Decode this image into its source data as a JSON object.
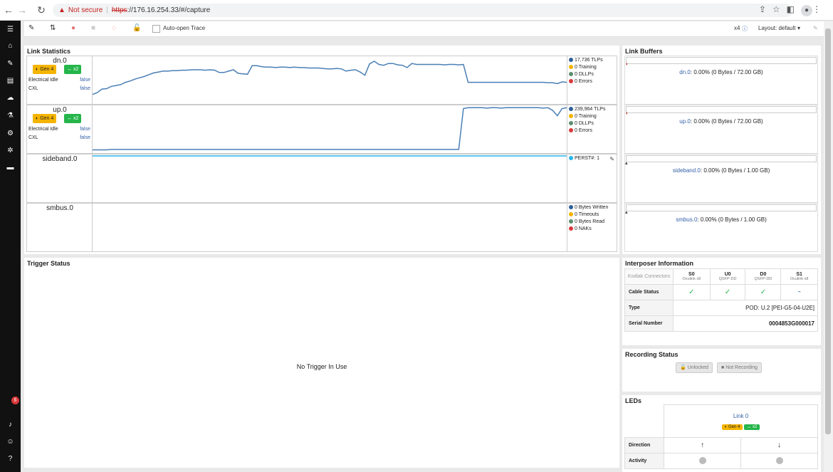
{
  "browser": {
    "warning": "Not secure",
    "url_protocol": "https",
    "url_rest": "://176.16.254.33/#/capture"
  },
  "notifications": {
    "count": "6"
  },
  "toolbar": {
    "auto_open_label": "Auto-open Trace",
    "zoom": "x4",
    "layout_label": "Layout: default"
  },
  "link_statistics": {
    "title": "Link Statistics",
    "rows": [
      {
        "name": "dn.0",
        "gen": "Gen 4",
        "width": "x2",
        "idle_label": "Electrical Idle",
        "idle_value": "false",
        "cxl_label": "CXL",
        "cxl_value": "false",
        "legend": [
          "17,736 TLPs",
          "0 Training",
          "0 DLLPs",
          "0 Errors"
        ]
      },
      {
        "name": "up.0",
        "gen": "Gen 4",
        "width": "x2",
        "idle_label": "Electrical Idle",
        "idle_value": "false",
        "cxl_label": "CXL",
        "cxl_value": "false",
        "legend": [
          "239,964 TLPs",
          "0 Training",
          "0 DLLPs",
          "0 Errors"
        ]
      },
      {
        "name": "sideband.0",
        "legend": [
          "PERST#: 1"
        ]
      },
      {
        "name": "smbus.0",
        "legend": [
          "0 Bytes Written",
          "0 Timeouts",
          "0 Bytes Read",
          "0 NAKs"
        ]
      }
    ],
    "legend_colors": [
      "#2e5f99",
      "#f4b400",
      "#5b8e6f",
      "#d9383a"
    ],
    "sideband_color": "#29b6e8"
  },
  "chart_data": {
    "type": "line",
    "series": [
      {
        "values": [
          18,
          22,
          30,
          31,
          36,
          38,
          40,
          45,
          48,
          52,
          55,
          58,
          62,
          66,
          68,
          70,
          70,
          71,
          71,
          72,
          72,
          73,
          73,
          73,
          72,
          73,
          72,
          67,
          67,
          70,
          73,
          65,
          64,
          63,
          82,
          82,
          80,
          79,
          79,
          78,
          79,
          79,
          78,
          79,
          78,
          78,
          77,
          77,
          77,
          76,
          75,
          75,
          76,
          75,
          70,
          72,
          73,
          68,
          61,
          86,
          92,
          85,
          83,
          87,
          87,
          84,
          83,
          78,
          87,
          85,
          85,
          85,
          85,
          85,
          85,
          84,
          85,
          85,
          84,
          85,
          45,
          45,
          45,
          45,
          45,
          45,
          45,
          45,
          45,
          45,
          45,
          45,
          45,
          45,
          45,
          45,
          45,
          44,
          44,
          42,
          46,
          45
        ]
      },
      {
        "values": [
          4,
          4,
          4,
          4,
          5,
          5,
          5,
          5,
          5,
          5,
          5,
          5,
          5,
          5,
          5,
          5,
          5,
          5,
          5,
          5,
          5,
          5,
          5,
          5,
          5,
          5,
          5,
          5,
          5,
          5,
          5,
          5,
          5,
          5,
          5,
          5,
          5,
          5,
          5,
          5,
          5,
          5,
          5,
          5,
          5,
          5,
          5,
          5,
          5,
          5,
          5,
          5,
          5,
          5,
          5,
          5,
          5,
          5,
          5,
          5,
          5,
          5,
          5,
          5,
          5,
          5,
          5,
          5,
          5,
          5,
          5,
          5,
          5,
          5,
          5,
          5,
          5,
          5,
          5,
          96,
          98,
          98,
          98,
          98,
          97,
          98,
          98,
          97,
          98,
          98,
          98,
          98,
          98,
          98,
          98,
          98,
          97,
          98,
          92,
          80,
          96,
          98
        ]
      },
      {
        "values": [
          100,
          100
        ]
      }
    ]
  },
  "trigger_status": {
    "title": "Trigger Status",
    "message": "No Trigger In Use"
  },
  "link_buffers": {
    "title": "Link Buffers",
    "items": [
      {
        "name": "dn.0",
        "text": ": 0.00% (0 Bytes / 72.00 GB)"
      },
      {
        "name": "up.0",
        "text": ": 0.00% (0 Bytes / 72.00 GB)"
      },
      {
        "name": "sideband.0",
        "text": ": 0.00% (0 Bytes / 1.00 GB)"
      },
      {
        "name": "smbus.0",
        "text": ": 0.00% (0 Bytes / 1.00 GB)"
      }
    ]
  },
  "interposer": {
    "title": "Interposer Information",
    "corner_label": "Kodiak Connectors",
    "connectors": [
      {
        "name": "S0",
        "sub": "Oculink x8",
        "status": "✓"
      },
      {
        "name": "U0",
        "sub": "QSFP-DD",
        "status": "✓"
      },
      {
        "name": "D0",
        "sub": "QSFP-DD",
        "status": "✓"
      },
      {
        "name": "S1",
        "sub": "Oculink x8",
        "status": "–"
      }
    ],
    "cable_status_label": "Cable Status",
    "type_label": "Type",
    "type_value": "POD: U.2 [PEI-G5-04-U2E]",
    "serial_label": "Serial Number",
    "serial_value": "0004853G000017"
  },
  "recording": {
    "title": "Recording Status",
    "unlocked": "Unlocked",
    "not_recording": "Not Recording"
  },
  "leds": {
    "title": "LEDs",
    "link": "Link 0",
    "gen": "Gen 4",
    "width": "x2",
    "direction_label": "Direction",
    "up_arrow": "↑",
    "down_arrow": "↓",
    "activity_label": "Activity"
  }
}
